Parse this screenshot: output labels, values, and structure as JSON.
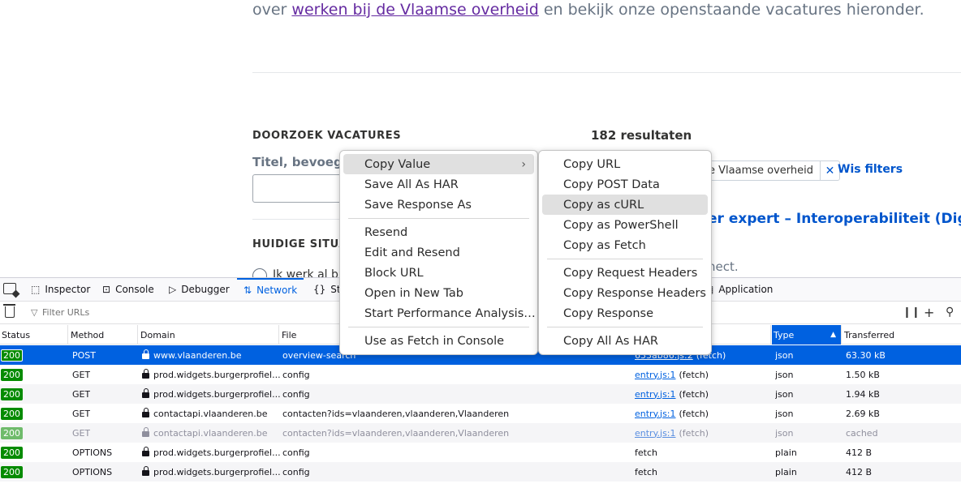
{
  "page": {
    "intro_prefix": "over ",
    "intro_link": "werken bij de Vlaamse overheid",
    "intro_suffix": " en bekijk onze openstaande vacatures hieronder.",
    "search_section_title": "DOORZOEK VACATURES",
    "search_field_label": "Titel, bevoegde",
    "results_count": "182 resultaten",
    "current_situation_title": "HUIDIGE SITUAT",
    "radio_label": "Ik werk al bi",
    "active_filter": "e Vlaamse overheid",
    "clear_filters": "Wis filters",
    "vacancy_title": "er expert – Interoperabiliteit (Digita",
    "vacancy_subtitle": "nect."
  },
  "devtools": {
    "tabs": [
      {
        "label": "Inspector",
        "icon": "inspector-icon"
      },
      {
        "label": "Console",
        "icon": "console-icon"
      },
      {
        "label": "Debugger",
        "icon": "debugger-icon"
      },
      {
        "label": "Network",
        "icon": "network-icon"
      },
      {
        "label": "St",
        "icon": "style-editor-icon"
      },
      {
        "label": "Application",
        "icon": "application-icon"
      }
    ],
    "filter_placeholder": "Filter URLs",
    "columns": [
      "Status",
      "Method",
      "Domain",
      "File",
      "Type",
      "Transferred"
    ],
    "sorted_column": "Type",
    "rows": [
      {
        "status": "200",
        "method": "POST",
        "domain": "www.vlaanderen.be",
        "file": "overview-search",
        "initiator": "633ab86.js:2",
        "cause": "(fetch)",
        "type": "json",
        "transferred": "63.30 kB",
        "selected": true
      },
      {
        "status": "200",
        "method": "GET",
        "domain": "prod.widgets.burgerprofiel...",
        "file": "config",
        "initiator": "entry.js:1",
        "cause": "(fetch)",
        "type": "json",
        "transferred": "1.50 kB"
      },
      {
        "status": "200",
        "method": "GET",
        "domain": "prod.widgets.burgerprofiel...",
        "file": "config",
        "initiator": "entry.js:1",
        "cause": "(fetch)",
        "type": "json",
        "transferred": "1.94 kB"
      },
      {
        "status": "200",
        "method": "GET",
        "domain": "contactapi.vlaanderen.be",
        "file": "contacten?ids=vlaanderen,vlaanderen,Vlaanderen",
        "initiator": "entry.js:1",
        "cause": "(fetch)",
        "type": "json",
        "transferred": "2.69 kB"
      },
      {
        "status": "200",
        "method": "GET",
        "domain": "contactapi.vlaanderen.be",
        "file": "contacten?ids=vlaanderen,vlaanderen,Vlaanderen",
        "initiator": "entry.js:1",
        "cause": "(fetch)",
        "type": "json",
        "transferred": "cached",
        "dim": true
      },
      {
        "status": "200",
        "method": "OPTIONS",
        "domain": "prod.widgets.burgerprofiel...",
        "file": "config",
        "initiator": "",
        "cause": "fetch",
        "type": "plain",
        "transferred": "412 B"
      },
      {
        "status": "200",
        "method": "OPTIONS",
        "domain": "prod.widgets.burgerprofiel...",
        "file": "config",
        "initiator": "",
        "cause": "fetch",
        "type": "plain",
        "transferred": "412 B"
      }
    ]
  },
  "context_menu": {
    "items": [
      {
        "label": "Copy Value",
        "has_submenu": true,
        "active": true
      },
      {
        "label": "Save All As HAR"
      },
      {
        "label": "Save Response As"
      },
      {
        "separator": true
      },
      {
        "label": "Resend"
      },
      {
        "label": "Edit and Resend"
      },
      {
        "label": "Block URL"
      },
      {
        "label": "Open in New Tab"
      },
      {
        "label": "Start Performance Analysis…"
      },
      {
        "separator": true
      },
      {
        "label": "Use as Fetch in Console"
      }
    ]
  },
  "copy_submenu": {
    "items": [
      {
        "label": "Copy URL"
      },
      {
        "label": "Copy POST Data"
      },
      {
        "label": "Copy as cURL",
        "active": true
      },
      {
        "label": "Copy as PowerShell"
      },
      {
        "label": "Copy as Fetch"
      },
      {
        "separator": true
      },
      {
        "label": "Copy Request Headers"
      },
      {
        "label": "Copy Response Headers"
      },
      {
        "label": "Copy Response"
      },
      {
        "separator": true
      },
      {
        "label": "Copy All As HAR"
      }
    ]
  },
  "colors": {
    "accent": "#0061e0",
    "link_visited": "#652ba1",
    "status_ok": "#058b00",
    "page_link": "#0055cc"
  }
}
